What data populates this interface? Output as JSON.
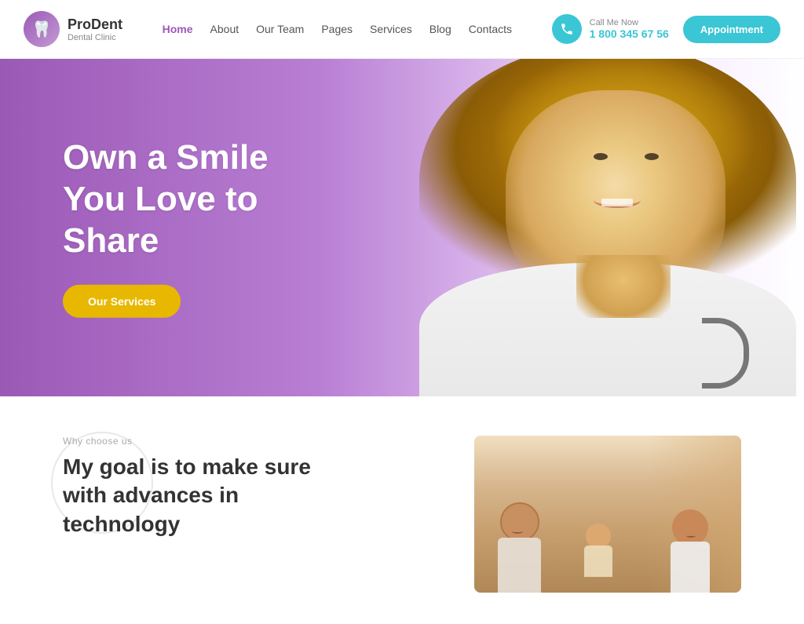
{
  "brand": {
    "name": "ProDent",
    "subtitle": "Dental Clinic",
    "logo_symbol": "🦷"
  },
  "nav": {
    "items": [
      {
        "label": "Home",
        "active": true
      },
      {
        "label": "About",
        "active": false
      },
      {
        "label": "Our Team",
        "active": false
      },
      {
        "label": "Pages",
        "active": false
      },
      {
        "label": "Services",
        "active": false
      },
      {
        "label": "Blog",
        "active": false
      },
      {
        "label": "Contacts",
        "active": false
      }
    ]
  },
  "header": {
    "call_label": "Call Me Now",
    "phone": "1 800 345 67 56",
    "appointment_label": "Appointment"
  },
  "hero": {
    "title_line1": "Own a Smile",
    "title_line2": "You Love to",
    "title_line3": "Share",
    "cta_label": "Our Services"
  },
  "below": {
    "why_label": "Why choose us",
    "heading_line1": "My goal is to make sure",
    "heading_line2": "with advances in",
    "heading_line3": "technology"
  },
  "colors": {
    "purple": "#9b59b6",
    "teal": "#3ac6d4",
    "yellow": "#e8b800",
    "white": "#ffffff"
  }
}
